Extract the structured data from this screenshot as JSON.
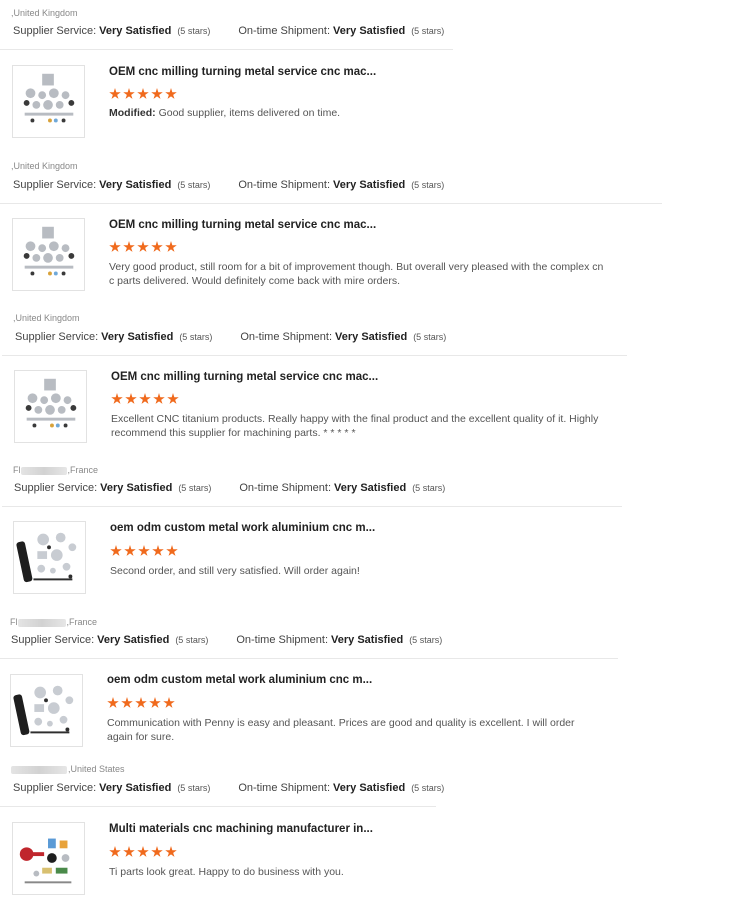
{
  "top_buyer": {
    "location": ",United Kingdom",
    "supplier_service_label": "Supplier Service:",
    "supplier_service_value": "Very Satisfied",
    "supplier_service_stars": "(5 stars)",
    "shipment_label": "On-time Shipment:",
    "shipment_value": "Very Satisfied",
    "shipment_stars": "(5 stars)"
  },
  "reviews": [
    {
      "product_title": "OEM cnc milling turning metal service cnc mac...",
      "rating": 5,
      "comment_prefix": "Modified:",
      "comment": "Good supplier, items delivered on time.",
      "thumb_icon": "cnc-parts-thumbnail",
      "buyer_location": ",United Kingdom",
      "supplier_service_label": "Supplier Service:",
      "supplier_service_value": "Very Satisfied",
      "supplier_service_stars": "(5 stars)",
      "shipment_label": "On-time Shipment:",
      "shipment_value": "Very Satisfied",
      "shipment_stars": "(5 stars)"
    },
    {
      "product_title": "OEM cnc milling turning metal service cnc mac...",
      "rating": 5,
      "comment_prefix": "",
      "comment": "Very good product, still room for a bit of improvement though. But overall very pleased with the complex cnc parts delivered. Would definitely come back with mire orders.",
      "thumb_icon": "cnc-parts-thumbnail",
      "buyer_location": ",United Kingdom",
      "supplier_service_label": "Supplier Service:",
      "supplier_service_value": "Very Satisfied",
      "supplier_service_stars": "(5 stars)",
      "shipment_label": "On-time Shipment:",
      "shipment_value": "Very Satisfied",
      "shipment_stars": "(5 stars)"
    },
    {
      "product_title": "OEM cnc milling turning metal service cnc mac...",
      "rating": 5,
      "comment_prefix": "",
      "comment": "Excellent CNC titanium products. Really happy with the final product and the excellent quality of it. Highly recommend this supplier for machining parts. * * * * *",
      "thumb_icon": "cnc-parts-thumbnail",
      "buyer_name_visible": "Fl",
      "buyer_location": ",France",
      "supplier_service_label": "Supplier Service:",
      "supplier_service_value": "Very Satisfied",
      "supplier_service_stars": "(5 stars)",
      "shipment_label": "On-time Shipment:",
      "shipment_value": "Very Satisfied",
      "shipment_stars": "(5 stars)"
    },
    {
      "product_title": "oem odm custom metal work aluminium cnc m...",
      "rating": 5,
      "comment_prefix": "",
      "comment": "Second order, and still very satisfied. Will order again!",
      "thumb_icon": "aluminium-parts-thumbnail",
      "buyer_name_visible": "Fl",
      "buyer_location": ",France",
      "supplier_service_label": "Supplier Service:",
      "supplier_service_value": "Very Satisfied",
      "supplier_service_stars": "(5 stars)",
      "shipment_label": "On-time Shipment:",
      "shipment_value": "Very Satisfied",
      "shipment_stars": "(5 stars)"
    },
    {
      "product_title": "oem odm custom metal work aluminium cnc m...",
      "rating": 5,
      "comment_prefix": "",
      "comment": "Communication with Penny is easy and pleasant. Prices are good and quality is excellent. I will order again for sure.",
      "thumb_icon": "aluminium-parts-thumbnail",
      "buyer_location": ",United States",
      "supplier_service_label": "Supplier Service:",
      "supplier_service_value": "Very Satisfied",
      "supplier_service_stars": "(5 stars)",
      "shipment_label": "On-time Shipment:",
      "shipment_value": "Very Satisfied",
      "shipment_stars": "(5 stars)"
    },
    {
      "product_title": "Multi materials cnc machining manufacturer in...",
      "rating": 5,
      "comment_prefix": "",
      "comment": "Ti parts look great. Happy to do business with you.",
      "thumb_icon": "multi-material-parts-thumbnail"
    }
  ],
  "colors": {
    "star": "#f06a1d",
    "divider": "#e8e8e8",
    "meta_text": "#888888"
  }
}
